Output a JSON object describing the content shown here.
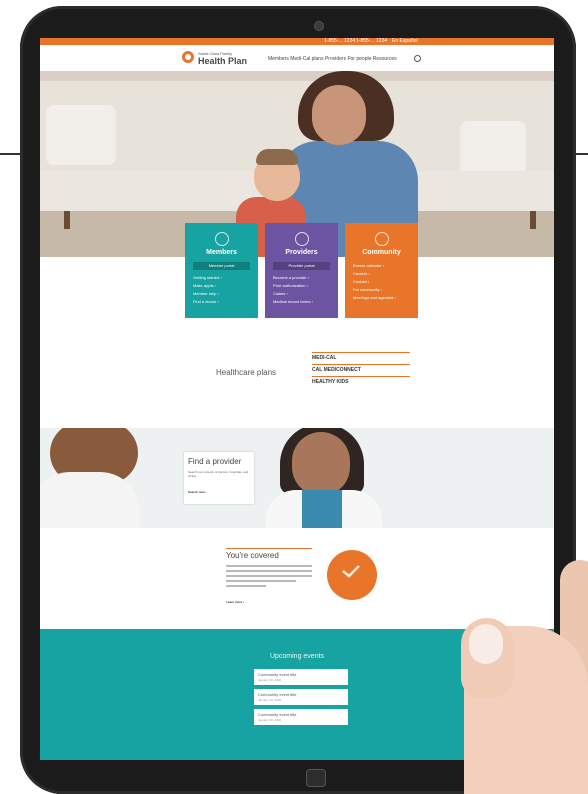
{
  "topbar": {
    "links": [
      "1-855-... 1234",
      "1-855-... 1234",
      "En Español"
    ]
  },
  "header": {
    "logo_small": "Santa Clara Family",
    "logo_big": "Health Plan",
    "nav": "Members  Medi-Cal plans  Providers  For people  Resources"
  },
  "cards": [
    {
      "title": "Members",
      "button": "Member portal",
      "links": [
        "Getting started ›",
        "Make appts ›",
        "Member help ›",
        "Find a doctor ›"
      ],
      "color": "#17a3a1"
    },
    {
      "title": "Providers",
      "button": "Provider portal",
      "links": [
        "Become a provider ›",
        "Prior authorization ›",
        "Claims ›",
        "Medical record forms ›"
      ],
      "color": "#6c54a3"
    },
    {
      "title": "Community",
      "links": [
        "Events calendar ›",
        "Careers ›",
        "Contact ›",
        "For community ›",
        "Meetings and agendas ›"
      ],
      "color": "#e8752a"
    }
  ],
  "plans": {
    "heading": "Healthcare plans",
    "items": [
      "MEDI-CAL",
      "CAL MEDICONNECT",
      "HEALTHY KIDS"
    ]
  },
  "provider_cta": {
    "title": "Find a provider",
    "text": "Search our network of doctors, hospitals, and clinics",
    "link": "Search now ›"
  },
  "covered": {
    "title": "You're covered",
    "link": "Learn more ›"
  },
  "teal_section": {
    "title": "Upcoming events",
    "events": [
      {
        "label": "Community event title",
        "date": "January 00, 2020"
      },
      {
        "label": "Community event title",
        "date": "January 00, 2020"
      },
      {
        "label": "Community event title",
        "date": "January 00, 2020"
      }
    ]
  },
  "colors": {
    "orange": "#e8752a",
    "teal": "#17a3a1",
    "purple": "#6c54a3"
  }
}
